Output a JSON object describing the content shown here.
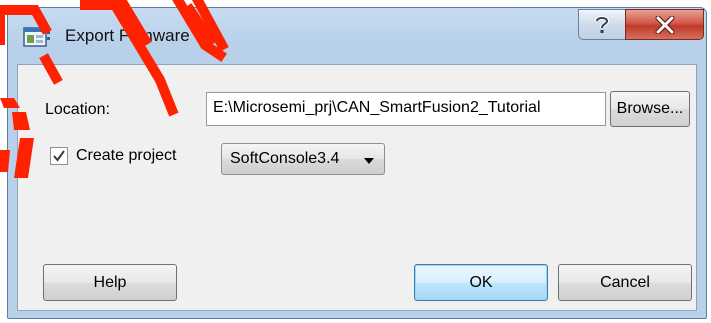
{
  "window": {
    "title": "Export Firmware",
    "help_icon": "question-icon",
    "close_icon": "close-x-icon"
  },
  "form": {
    "location_label": "Location:",
    "location_value": "E:\\Microsemi_prj\\CAN_SmartFusion2_Tutorial",
    "browse_label": "Browse...",
    "create_project_label": "Create project",
    "create_project_checked": true,
    "project_type_selected": "SoftConsole3.4"
  },
  "buttons": {
    "help_label": "Help",
    "ok_label": "OK",
    "cancel_label": "Cancel"
  },
  "colors": {
    "watermark": "#ff2200",
    "close_button": "#c7463a",
    "default_button_border": "#3c7fb1"
  }
}
